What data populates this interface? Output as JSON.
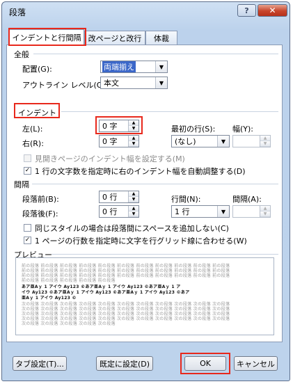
{
  "window": {
    "title": "段落",
    "help": "?",
    "close": "✕"
  },
  "tabs": [
    {
      "label": "インデントと行間隔"
    },
    {
      "label": "改ページと改行"
    },
    {
      "label": "体裁"
    }
  ],
  "general": {
    "heading": "全般",
    "alignment_label": "配置(G):",
    "alignment_value": "両端揃え",
    "outline_label": "アウトライン レベル(O):",
    "outline_value": "本文"
  },
  "indent": {
    "heading": "インデント",
    "left_label": "左(L):",
    "left_value": "0 字",
    "right_label": "右(R):",
    "right_value": "0 字",
    "first_line_label": "最初の行(S):",
    "first_line_value": "(なし)",
    "width_label": "幅(Y):",
    "width_value": "",
    "mirror_label": "見開きページのインデント幅を設定する(M)",
    "mirror_checked": false,
    "auto_adjust_label": "1 行の文字数を指定時に右のインデント幅を自動調整する(D)",
    "auto_adjust_checked": true
  },
  "spacing": {
    "heading": "間隔",
    "before_label": "段落前(B):",
    "before_value": "0 行",
    "after_label": "段落後(F):",
    "after_value": "0 行",
    "line_label": "行間(N):",
    "line_value": "1 行",
    "at_label": "間隔(A):",
    "at_value": "",
    "no_space_label": "同じスタイルの場合は段落間にスペースを追加しない(C)",
    "no_space_checked": false,
    "grid_label": "1 ページの行数を指定時に文字を行グリッド線に合わせる(W)",
    "grid_checked": true
  },
  "preview": {
    "heading": "プレビュー",
    "prev_lines": [
      "前の段落 前の段落 前の段落 前の段落 前の段落 前の段落 前の段落 前の段落 前の段落 前の段落 前の段落",
      "前の段落 前の段落 前の段落 前の段落 前の段落 前の段落 前の段落 前の段落 前の段落 前の段落 前の段落",
      "前の段落 前の段落 前の段落 前の段落 前の段落 前の段落 前の段落 前の段落 前の段落 前の段落 前の段落",
      "前の段落 前の段落 前の段落 前の段落 前の段落"
    ],
    "sample_lines": [
      "あア亜Aｙ 1 アイウ Ay123 ©あア亜Aｙ 1 アイウ Ay123 ©あア亜Aｙ 1 ア",
      "イウ Ay123 ©あア亜Aｙ 1 アイウ Ay123 ©あア亜Aｙ 1 アイウ Ay123 ©あア",
      "亜Aｙ 1 アイウ Ay123 ©"
    ],
    "next_lines": [
      "次の段落 次の段落 次の段落 次の段落 次の段落 次の段落 次の段落 次の段落 次の段落 次の段落 次の段落",
      "次の段落 次の段落 次の段落 次の段落 次の段落 次の段落 次の段落 次の段落 次の段落 次の段落 次の段落",
      "次の段落 次の段落 次の段落 次の段落 次の段落 次の段落 次の段落 次の段落 次の段落 次の段落 次の段落",
      "次の段落 次の段落 次の段落 次の段落 次の段落 次の段落 次の段落 次の段落 次の段落 次の段落 次の段落",
      "次の段落 次の段落 次の段落 次の段落 次の段落"
    ]
  },
  "buttons": {
    "tabs": "タブ設定(T)...",
    "default": "既定に設定(D)",
    "ok": "OK",
    "cancel": "キャンセル"
  },
  "colors": {
    "highlight": "#e8281c",
    "selection": "#3b67c9"
  }
}
